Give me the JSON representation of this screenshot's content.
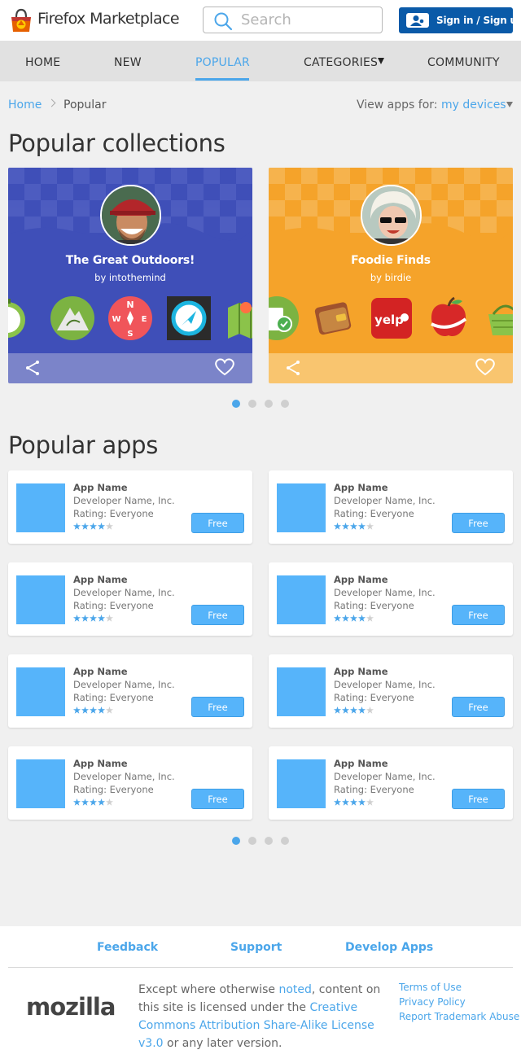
{
  "header": {
    "brand": "Firefox Marketplace",
    "search_placeholder": "Search",
    "signin_label": "Sign in / Sign up"
  },
  "nav": {
    "items": [
      "HOME",
      "NEW",
      "POPULAR",
      "CATEGORIES",
      "COMMUNITY"
    ],
    "active": "POPULAR"
  },
  "breadcrumb": {
    "home": "Home",
    "current": "Popular"
  },
  "view_for": {
    "prefix": "View apps for: ",
    "link": "my devices"
  },
  "collections_section": {
    "title": "Popular collections",
    "cards": [
      {
        "title": "The Great Outdoors!",
        "by": "by intothemind",
        "color": "#3f4fb8",
        "bar_color": "#7b84c9"
      },
      {
        "title": "Foodie Finds",
        "by": "by birdie",
        "color": "#f5a32a",
        "bar_color": "#f9c56f"
      }
    ],
    "pager": {
      "count": 4,
      "active": 1
    }
  },
  "apps_section": {
    "title": "Popular apps",
    "apps": [
      {
        "name": "App Name",
        "developer": "Developer Name, Inc.",
        "rating": "Rating: Everyone",
        "stars": 4,
        "price": "Free"
      },
      {
        "name": "App Name",
        "developer": "Developer Name, Inc.",
        "rating": "Rating: Everyone",
        "stars": 4,
        "price": "Free"
      },
      {
        "name": "App Name",
        "developer": "Developer Name, Inc.",
        "rating": "Rating: Everyone",
        "stars": 4,
        "price": "Free"
      },
      {
        "name": "App Name",
        "developer": "Developer Name, Inc.",
        "rating": "Rating: Everyone",
        "stars": 4,
        "price": "Free"
      },
      {
        "name": "App Name",
        "developer": "Developer Name, Inc.",
        "rating": "Rating: Everyone",
        "stars": 4,
        "price": "Free"
      },
      {
        "name": "App Name",
        "developer": "Developer Name, Inc.",
        "rating": "Rating: Everyone",
        "stars": 4,
        "price": "Free"
      },
      {
        "name": "App Name",
        "developer": "Developer Name, Inc.",
        "rating": "Rating: Everyone",
        "stars": 4,
        "price": "Free"
      },
      {
        "name": "App Name",
        "developer": "Developer Name, Inc.",
        "rating": "Rating: Everyone",
        "stars": 4,
        "price": "Free"
      }
    ],
    "pager": {
      "count": 4,
      "active": 1
    }
  },
  "footer": {
    "links": [
      "Feedback",
      "Support",
      "Develop Apps"
    ],
    "logo": "mozilla",
    "license_parts": [
      "Except where otherwise ",
      "noted",
      ", content on this site is licensed under the ",
      "Creative Commons Attribution Share-Alike License v3.0",
      " or any later version."
    ],
    "legal": [
      "Terms of Use",
      "Privacy Policy",
      "Report Trademark Abuse"
    ]
  },
  "colors": {
    "accent": "#4ba6ea",
    "signin_bg": "#0a5aa8",
    "app_tile": "#56b4fa"
  }
}
